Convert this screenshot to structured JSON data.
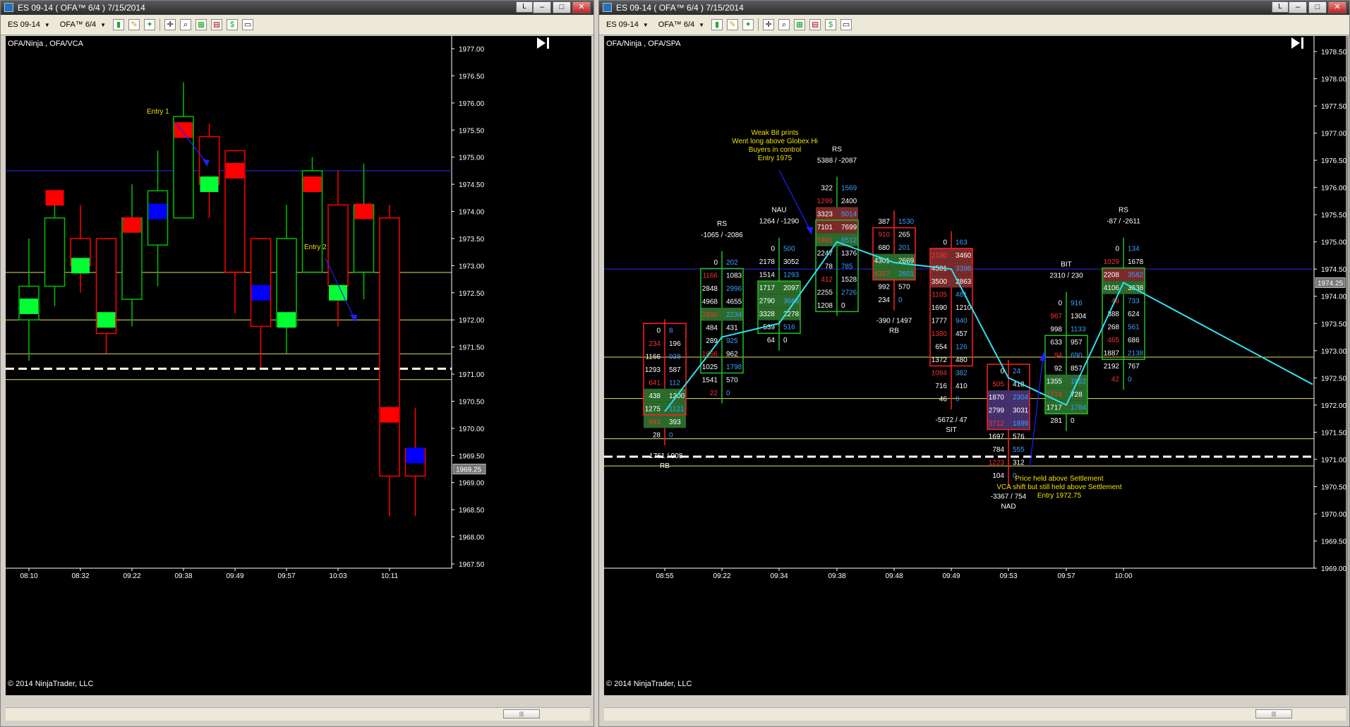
{
  "left_window": {
    "title": "ES 09-14 ( OFA™ 6/4 )  7/15/2014",
    "instrument_selector": "ES 09-14",
    "period_selector": "OFA™ 6/4",
    "button_l": "L",
    "chart_label": "OFA/Ninja , OFA/VCA",
    "copyright": "© 2014 NinjaTrader, LLC",
    "price_labels": [
      "1977.00",
      "1976.50",
      "1976.00",
      "1975.50",
      "1975.00",
      "1974.50",
      "1974.00",
      "1973.50",
      "1973.00",
      "1972.50",
      "1972.00",
      "1971.50",
      "1971.00",
      "1970.50",
      "1970.00",
      "1969.50",
      "1969.00",
      "1968.50",
      "1968.00",
      "1967.50"
    ],
    "current_price": "1969.25",
    "time_labels": [
      "08:10",
      "08:32",
      "09:22",
      "09:38",
      "09:49",
      "09:57",
      "10:03",
      "10:11"
    ],
    "annotations": [
      "Entry 1",
      "Entry 2"
    ]
  },
  "right_window": {
    "title": "ES 09-14 ( OFA™ 6/4 )  7/15/2014",
    "instrument_selector": "ES 09-14",
    "period_selector": "OFA™ 6/4",
    "button_l": "L",
    "chart_label": "OFA/Ninja , OFA/SPA",
    "copyright": "© 2014 NinjaTrader, LLC",
    "price_labels": [
      "1978.50",
      "1978.00",
      "1977.50",
      "1977.00",
      "1976.50",
      "1976.00",
      "1975.50",
      "1975.00",
      "1974.50",
      "1974.00",
      "1973.50",
      "1973.00",
      "1972.50",
      "1972.00",
      "1971.50",
      "1971.00",
      "1970.50",
      "1970.00",
      "1969.50",
      "1969.00"
    ],
    "current_price": "1974.25",
    "time_labels": [
      "08:55",
      "09:22",
      "09:34",
      "09:38",
      "09:48",
      "09:49",
      "09:53",
      "09:57",
      "10:00"
    ],
    "notes": {
      "weak_bit": [
        "Weak Bit prints",
        "Went long above Globex Hi",
        "Buyers in control",
        "Entry 1975"
      ],
      "settlement": [
        "Price held above Settlement",
        "VCA shift but still held above Settlement",
        "Entry 1972.75"
      ]
    },
    "bar_labels": [
      {
        "top": "",
        "delta": "-1761 / 908",
        "tag": "RB"
      },
      {
        "top": "RS",
        "delta": "-1065 / -2086",
        "tag": ""
      },
      {
        "top": "NAU",
        "delta": "1264 / -1290",
        "tag": ""
      },
      {
        "top": "RS",
        "delta": "5388 / -2087",
        "tag": ""
      },
      {
        "top": "",
        "delta": "-390 / 1497",
        "tag": "RB"
      },
      {
        "top": "",
        "delta": "-5672 / 47",
        "tag": "SIT"
      },
      {
        "top": "",
        "delta": "-3367 / 754",
        "tag": "NAD"
      },
      {
        "top": "BIT",
        "delta": "2310 / 230",
        "tag": ""
      },
      {
        "top": "RS",
        "delta": "-87 / -2611",
        "tag": ""
      }
    ]
  },
  "chart_data": [
    {
      "type": "candlestick",
      "title": "",
      "series_label": "OFA/Ninja , OFA/VCA",
      "ylim": [
        1967.5,
        1977.0
      ],
      "reference_lines": {
        "blue": 1974.75,
        "yellow": [
          1972.0,
          1972.875,
          1971.375,
          1970.9
        ],
        "settlement_dashed": 1971.1
      },
      "candles": [
        {
          "o": 1972.0,
          "h": 1973.5,
          "l": 1971.25,
          "c": 1972.62,
          "marker": 1972.25,
          "marker_color": "green"
        },
        {
          "o": 1972.62,
          "h": 1974.25,
          "l": 1972.25,
          "c": 1973.88,
          "marker": 1974.25,
          "marker_color": "red"
        },
        {
          "o": 1973.5,
          "h": 1974.12,
          "l": 1972.5,
          "c": 1973.0,
          "marker": 1973.0,
          "marker_color": "green"
        },
        {
          "o": 1973.5,
          "h": 1973.5,
          "l": 1971.38,
          "c": 1971.75,
          "marker": 1972.0,
          "marker_color": "green"
        },
        {
          "o": 1972.38,
          "h": 1974.5,
          "l": 1971.88,
          "c": 1973.88,
          "marker": 1973.75,
          "marker_color": "red"
        },
        {
          "o": 1973.38,
          "h": 1975.12,
          "l": 1972.62,
          "c": 1974.38,
          "marker": 1974.0,
          "marker_color": "blue"
        },
        {
          "o": 1973.88,
          "h": 1976.38,
          "l": 1973.88,
          "c": 1975.75,
          "marker": 1975.5,
          "marker_color": "red"
        },
        {
          "o": 1975.38,
          "h": 1975.62,
          "l": 1973.88,
          "c": 1974.5,
          "marker": 1974.5,
          "marker_color": "green"
        },
        {
          "o": 1975.12,
          "h": 1975.12,
          "l": 1972.12,
          "c": 1972.88,
          "marker": 1974.75,
          "marker_color": "red"
        },
        {
          "o": 1973.5,
          "h": 1973.5,
          "l": 1971.12,
          "c": 1971.88,
          "marker": 1972.5,
          "marker_color": "blue"
        },
        {
          "o": 1971.88,
          "h": 1974.12,
          "l": 1971.38,
          "c": 1973.5,
          "marker": 1972.0,
          "marker_color": "green"
        },
        {
          "o": 1972.88,
          "h": 1975.0,
          "l": 1972.88,
          "c": 1974.75,
          "marker": 1974.5,
          "marker_color": "red"
        },
        {
          "o": 1974.12,
          "h": 1974.75,
          "l": 1971.88,
          "c": 1972.62,
          "marker": 1972.5,
          "marker_color": "green"
        },
        {
          "o": 1972.88,
          "h": 1974.88,
          "l": 1972.38,
          "c": 1974.12,
          "marker": 1974.0,
          "marker_color": "red"
        },
        {
          "o": 1973.88,
          "h": 1974.12,
          "l": 1968.38,
          "c": 1969.12,
          "marker": 1970.25,
          "marker_color": "red"
        },
        {
          "o": 1969.62,
          "h": 1970.38,
          "l": 1968.38,
          "c": 1969.12,
          "marker": 1969.5,
          "marker_color": "blue"
        }
      ]
    },
    {
      "type": "footprint",
      "title": "",
      "series_label": "OFA/Ninja , OFA/SPA",
      "ylim": [
        1969.0,
        1978.5
      ],
      "reference_lines": {
        "blue": 1974.5,
        "yellow": [
          1972.12,
          1972.88,
          1971.38,
          1970.88
        ],
        "settlement_dashed": 1971.05
      },
      "polyline": [
        1971.88,
        1973.25,
        1973.5,
        1975.0,
        1974.62,
        1974.5,
        1972.5,
        1972.0,
        1974.25,
        1972.38
      ],
      "columns": [
        {
          "cells": [
            [
              "0",
              "8"
            ],
            [
              "234",
              "196"
            ],
            [
              "1166",
              "938"
            ],
            [
              "1293",
              "587"
            ],
            [
              "641",
              "112"
            ],
            [
              "438",
              "1200"
            ],
            [
              "1275",
              "1121"
            ],
            [
              "943",
              "393"
            ],
            [
              "28",
              "0"
            ]
          ],
          "top": 1973.5,
          "box_rows": [
            0,
            6
          ],
          "green_rows": [
            5,
            6,
            7
          ]
        },
        {
          "cells": [
            [
              "0",
              "202"
            ],
            [
              "1166",
              "1083"
            ],
            [
              "2848",
              "2996"
            ],
            [
              "4968",
              "4655"
            ],
            [
              "2930",
              "2234"
            ],
            [
              "484",
              "431"
            ],
            [
              "289",
              "925"
            ],
            [
              "1666",
              "962"
            ],
            [
              "1025",
              "1798"
            ],
            [
              "1541",
              "570"
            ],
            [
              "22",
              "0"
            ]
          ],
          "top": 1974.75,
          "box_rows": [
            1,
            8
          ],
          "green_rows": [
            4
          ]
        },
        {
          "cells": [
            [
              "0",
              "500"
            ],
            [
              "2178",
              "3052"
            ],
            [
              "1514",
              "1293"
            ],
            [
              "1717",
              "2097"
            ],
            [
              "2790",
              "3668"
            ],
            [
              "3328",
              "2278"
            ],
            [
              "539",
              "516"
            ],
            [
              "64",
              "0"
            ]
          ],
          "top": 1975.0,
          "box_rows": [
            3,
            6
          ],
          "green_rows": [
            3,
            4,
            5
          ]
        },
        {
          "cells": [
            [
              "322",
              "1569"
            ],
            [
              "1299",
              "2400"
            ],
            [
              "3323",
              "5014"
            ],
            [
              "7101",
              "7699"
            ],
            [
              "5981",
              "6512"
            ],
            [
              "2247",
              "1376"
            ],
            [
              "78",
              "785"
            ],
            [
              "412",
              "1528"
            ],
            [
              "2255",
              "2726"
            ],
            [
              "1208",
              "0"
            ]
          ],
          "top": 1976.12,
          "box_rows": [
            3,
            9
          ],
          "green_rows": [
            4
          ]
        },
        {
          "cells": [
            [
              "387",
              "1530"
            ],
            [
              "910",
              "265"
            ],
            [
              "680",
              "201"
            ],
            [
              "4301",
              "2669"
            ],
            [
              "4327",
              "2601"
            ],
            [
              "992",
              "570"
            ],
            [
              "234",
              "0"
            ]
          ],
          "top": 1975.5,
          "box_rows": [
            1,
            4
          ],
          "green_rows": [
            3,
            4
          ]
        },
        {
          "cells": [
            [
              "0",
              "163"
            ],
            [
              "2190",
              "3460"
            ],
            [
              "4501",
              "3398"
            ],
            [
              "3500",
              "2863"
            ],
            [
              "1105",
              "481"
            ],
            [
              "1690",
              "1210"
            ],
            [
              "1777",
              "940"
            ],
            [
              "1380",
              "457"
            ],
            [
              "654",
              "126"
            ],
            [
              "1372",
              "480"
            ],
            [
              "1084",
              "382"
            ],
            [
              "716",
              "410"
            ],
            [
              "46",
              "0"
            ]
          ],
          "top": 1975.12,
          "box_rows": [
            1,
            9
          ],
          "green_rows": []
        },
        {
          "cells": [
            [
              "0",
              "24"
            ],
            [
              "505",
              "418"
            ],
            [
              "1870",
              "2304"
            ],
            [
              "2799",
              "3031"
            ],
            [
              "3712",
              "1899"
            ],
            [
              "1697",
              "576"
            ],
            [
              "784",
              "555"
            ],
            [
              "1223",
              "312"
            ],
            [
              "104",
              "0"
            ]
          ],
          "top": 1972.75,
          "box_rows": [
            0,
            4
          ],
          "green_rows": []
        },
        {
          "cells": [
            [
              "0",
              "916"
            ],
            [
              "967",
              "1304"
            ],
            [
              "998",
              "1133"
            ],
            [
              "633",
              "957"
            ],
            [
              "94",
              "690"
            ],
            [
              "92",
              "857"
            ],
            [
              "1355",
              "1852"
            ],
            [
              "1774",
              "728"
            ],
            [
              "1717",
              "1784"
            ],
            [
              "281",
              "0"
            ]
          ],
          "top": 1974.0,
          "box_rows": [
            3,
            8
          ],
          "green_rows": [
            6,
            7,
            8
          ]
        },
        {
          "cells": [
            [
              "0",
              "134"
            ],
            [
              "1029",
              "1678"
            ],
            [
              "2208",
              "3582"
            ],
            [
              "4106",
              "3638"
            ],
            [
              "48",
              "733"
            ],
            [
              "388",
              "624"
            ],
            [
              "268",
              "561"
            ],
            [
              "465",
              "686"
            ],
            [
              "1887",
              "2138"
            ],
            [
              "2192",
              "767"
            ],
            [
              "42",
              "0"
            ]
          ],
          "top": 1975.0,
          "box_rows": [
            2,
            8
          ],
          "green_rows": [
            3
          ]
        }
      ]
    }
  ]
}
